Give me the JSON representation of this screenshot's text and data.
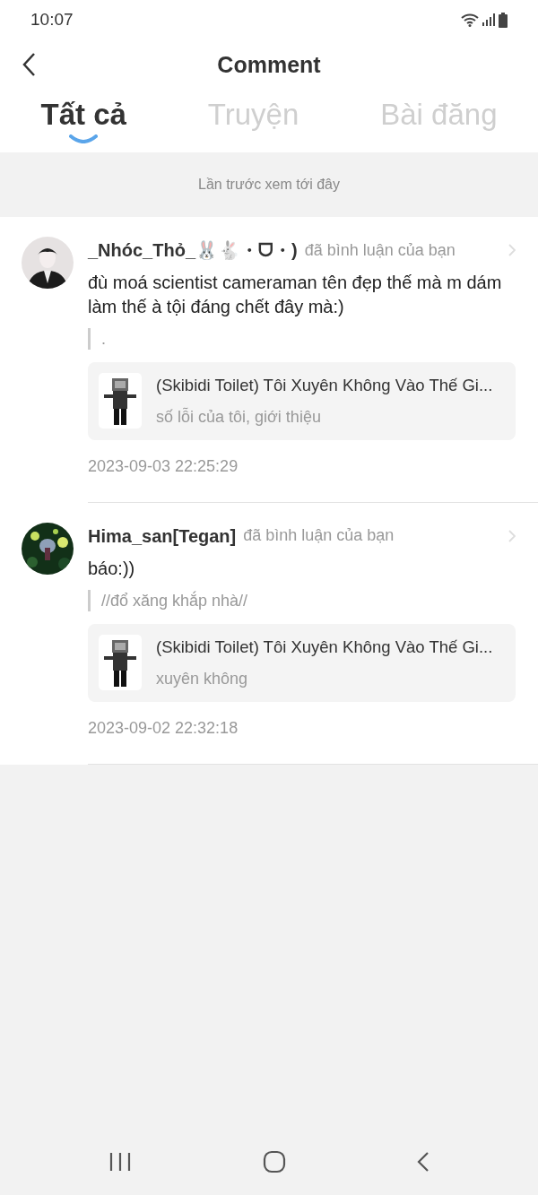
{
  "status_bar": {
    "time": "10:07"
  },
  "header": {
    "title": "Comment"
  },
  "tabs": [
    {
      "label": "Tất cả",
      "selected": true
    },
    {
      "label": "Truyện",
      "selected": false
    },
    {
      "label": "Bài đăng",
      "selected": false
    }
  ],
  "notice": "Lần trước xem tới đây",
  "comments": [
    {
      "user": "_Nhóc_Thỏ_🐰🐇・ᗜ・)",
      "action": "đã bình luận của bạn",
      "text": "đù moá scientist cameraman tên đẹp thế mà m dám làm thế à tội đáng chết đây mà:)",
      "quote": ".",
      "story": {
        "title": "(Skibidi Toilet) Tôi Xuyên Không Vào Thế Gi...",
        "subtitle": "số lỗi của tôi, giới thiệu"
      },
      "time": "2023-09-03 22:25:29"
    },
    {
      "user": "Hima_san[Tegan]",
      "action": "đã bình luận của bạn",
      "text": "báo:))",
      "quote": "//đổ xăng khắp nhà//",
      "story": {
        "title": "(Skibidi Toilet) Tôi Xuyên Không Vào Thế Gi...",
        "subtitle": "xuyên không"
      },
      "time": "2023-09-02 22:32:18"
    }
  ]
}
